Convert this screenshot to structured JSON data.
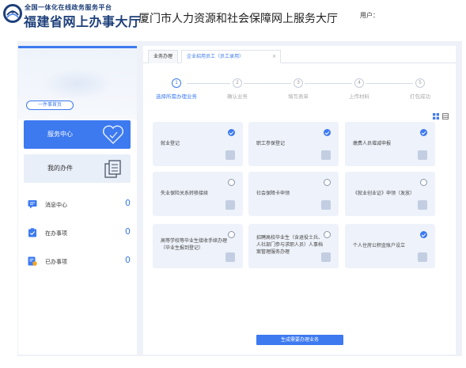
{
  "header": {
    "logo_small": "全国一体化在线政务服务平台",
    "logo_big": "福建省网上办事大厅",
    "site_title": "厦门市人力资源和社会保障网上服务大厅",
    "user_label": "用户："
  },
  "sidebar": {
    "back_home": "一件事首页",
    "service_center": "服务中心",
    "my_work": "我的办件",
    "items": [
      {
        "label": "消息中心",
        "count": "0"
      },
      {
        "label": "在办事项",
        "count": "0"
      },
      {
        "label": "已办事项",
        "count": "0"
      }
    ]
  },
  "main": {
    "tabs": [
      {
        "label": "业务办理"
      },
      {
        "label": "企业招用员工（员工录用）"
      }
    ],
    "steps": [
      {
        "num": "1",
        "label": "选择所需办理业务"
      },
      {
        "num": "2",
        "label": "确认业务"
      },
      {
        "num": "3",
        "label": "填写表单"
      },
      {
        "num": "4",
        "label": "上传材料"
      },
      {
        "num": "5",
        "label": "打包成功"
      }
    ],
    "cards": [
      {
        "title": "就业登记",
        "checked": true
      },
      {
        "title": "职工参保登记",
        "checked": true
      },
      {
        "title": "缴费人员增减申报",
        "checked": true
      },
      {
        "title": "失业保险关系转移接续",
        "checked": false
      },
      {
        "title": "社会保障卡申领",
        "checked": false
      },
      {
        "title": "《就业创业证》申领（发放）",
        "checked": false
      },
      {
        "title": "高等学校等毕业生接收手续办理（毕业生报到登记）",
        "checked": false
      },
      {
        "title": "招聘高校毕业生（含退役士兵、人社部门参与求职人员）人事档案管理服务办理",
        "checked": false
      },
      {
        "title": "个人住房公积金账户设立",
        "checked": true
      }
    ],
    "generate_button": "生成需要办理业务"
  },
  "colors": {
    "accent": "#3d7af0",
    "card_bg": "#eef2fa",
    "page_bg": "#eef2f8"
  }
}
